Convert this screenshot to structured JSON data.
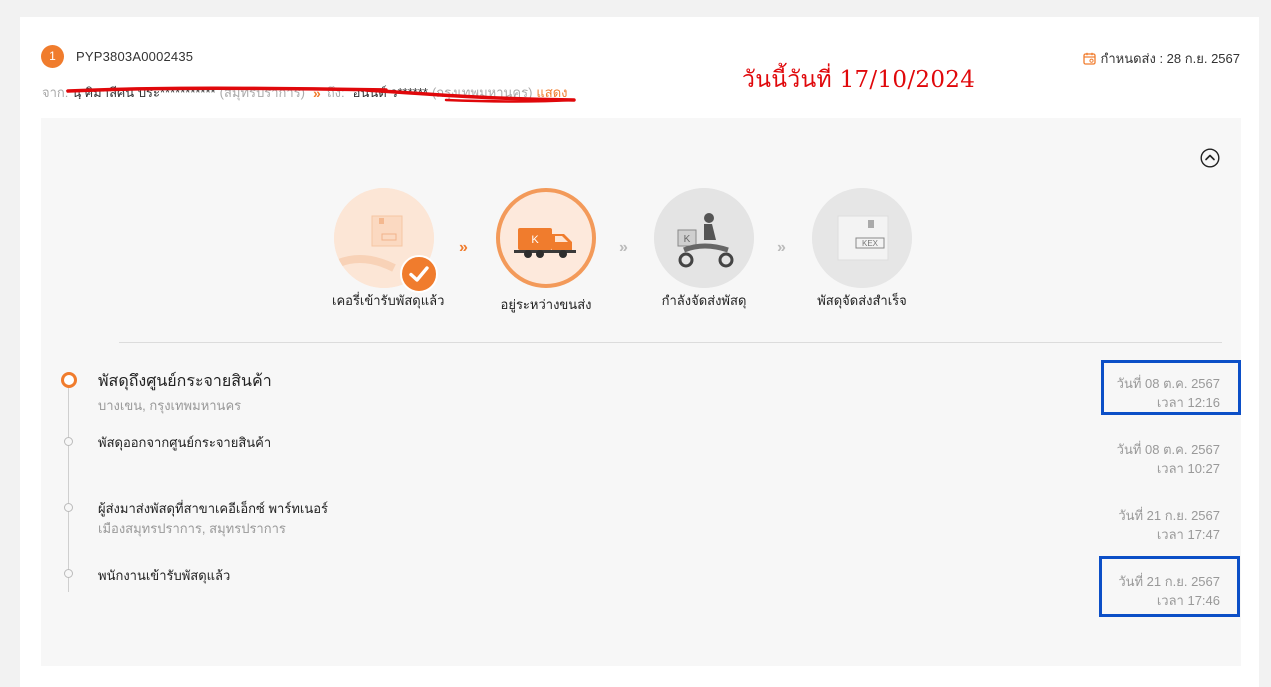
{
  "shipment": {
    "index": "1",
    "tracking_no": "PYP3803A0002435",
    "deadline": "กำหนดส่ง : 28 ก.ย. 2567",
    "route": {
      "from_label": "จาก:",
      "from_name": "นฺ ศิมาลีศน ประ***********",
      "from_area": "(สมุทรปราการ)",
      "arrow": "»",
      "to_label": "ถึง:",
      "to_name": "อนนต์ ว******",
      "to_area": "(กรุงเทพมหานคร)",
      "show_link": "แสดง"
    }
  },
  "annotation": {
    "today_note": "วันนี้วันที่ 17/10/2024"
  },
  "steps": [
    {
      "label": "เคอรี่เข้ารับพัสดุแล้ว"
    },
    {
      "label": "อยู่ระหว่างขนส่ง"
    },
    {
      "label": "กำลังจัดส่งพัสดุ"
    },
    {
      "label": "พัสดุจัดส่งสำเร็จ"
    }
  ],
  "steps_chevron": "»",
  "events": [
    {
      "title": "พัสดุถึงศูนย์กระจายสินค้า",
      "subtitle": "บางเขน, กรุงเทพมหานคร",
      "date": "วันที่ 08 ต.ค. 2567",
      "time": "เวลา 12:16"
    },
    {
      "title": "พัสดุออกจากศูนย์กระจายสินค้า",
      "subtitle": "",
      "date": "วันที่ 08 ต.ค. 2567",
      "time": "เวลา 10:27"
    },
    {
      "title": "ผู้ส่งมาส่งพัสดุที่สาขาเคอีเอ็กซ์ พาร์ทเนอร์",
      "subtitle": "เมืองสมุทรปราการ, สมุทรปราการ",
      "date": "วันที่ 21 ก.ย. 2567",
      "time": "เวลา 17:47"
    },
    {
      "title": "พนักงานเข้ารับพัสดุแล้ว",
      "subtitle": "",
      "date": "วันที่ 21 ก.ย. 2567",
      "time": "เวลา 17:46"
    }
  ],
  "colors": {
    "accent": "#f07c2d",
    "annotation_red": "#e0080b",
    "annotation_blue": "#0c4fc7"
  },
  "icons": {
    "deadline": "calendar-icon",
    "collapse": "chevron-up-circle-icon",
    "done": "check-circle-icon"
  }
}
